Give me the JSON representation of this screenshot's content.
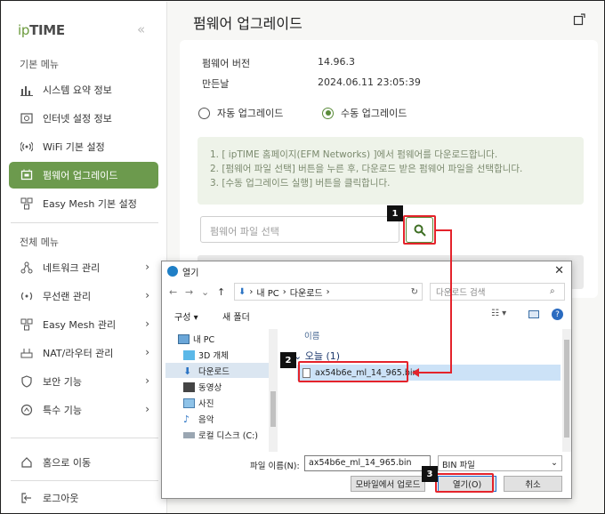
{
  "colors": {
    "accent": "#6c9a4d",
    "callout_red": "#e4232b"
  },
  "sidebar": {
    "logo_prefix": "ip",
    "logo_brand": "TIME",
    "section_basic": "기본 메뉴",
    "section_all": "전체 메뉴",
    "basic_items": [
      {
        "label": "시스템 요약 정보",
        "icon": "bar-chart-icon"
      },
      {
        "label": "인터넷 설정 정보",
        "icon": "globe-window-icon"
      },
      {
        "label": "WiFi 기본 설정",
        "icon": "wifi-icon"
      },
      {
        "label": "펌웨어 업그레이드",
        "icon": "firmware-icon",
        "active": true
      },
      {
        "label": "Easy Mesh 기본 설정",
        "icon": "mesh-icon"
      }
    ],
    "all_items": [
      {
        "label": "네트워크 관리",
        "icon": "network-icon"
      },
      {
        "label": "무선랜 관리",
        "icon": "wireless-icon"
      },
      {
        "label": "Easy Mesh 관리",
        "icon": "mesh-icon"
      },
      {
        "label": "NAT/라우터 관리",
        "icon": "router-icon"
      },
      {
        "label": "보안 기능",
        "icon": "shield-icon"
      },
      {
        "label": "특수 기능",
        "icon": "special-icon"
      }
    ],
    "home_label": "홈으로 이동",
    "logout_label": "로그아웃"
  },
  "main": {
    "title": "펌웨어 업그레이드",
    "firmware_version_label": "펌웨어 버전",
    "firmware_version_value": "14.96.3",
    "build_date_label": "만든날",
    "build_date_value": "2024.06.11 23:05:39",
    "radio_auto": "자동 업그레이드",
    "radio_manual": "수동 업그레이드",
    "help": [
      "1. [ ipTIME 홈페이지(EFM Networks) ]에서 펌웨어를 다운로드합니다.",
      "2. [펌웨어 파일 선택] 버튼을 누른 후, 다운로드 받은 펌웨어 파일을 선택합니다.",
      "3. [수동 업그레이드 실행] 버튼을 클릭합니다."
    ],
    "file_placeholder": "펌웨어 파일 선택"
  },
  "callouts": [
    "1",
    "2",
    "3"
  ],
  "dialog": {
    "title": "열기",
    "breadcrumb_pc": "내 PC",
    "breadcrumb_downloads": "다운로드",
    "search_placeholder": "다운로드 검색",
    "organize": "구성",
    "new_folder": "새 폴더",
    "tree": [
      "내 PC",
      "3D 개체",
      "다운로드",
      "동영상",
      "사진",
      "음악",
      "로컬 디스크 (C:)"
    ],
    "column_name": "이름",
    "group_today": "오늘 (1)",
    "file_name": "ax54b6e_ml_14_965.bin",
    "filename_label": "파일 이름(N):",
    "filename_value": "ax54b6e_ml_14_965.bin",
    "filetype": "BIN 파일",
    "btn_mobile": "모바일에서 업로드",
    "btn_open": "열기(O)",
    "btn_cancel": "취소"
  }
}
